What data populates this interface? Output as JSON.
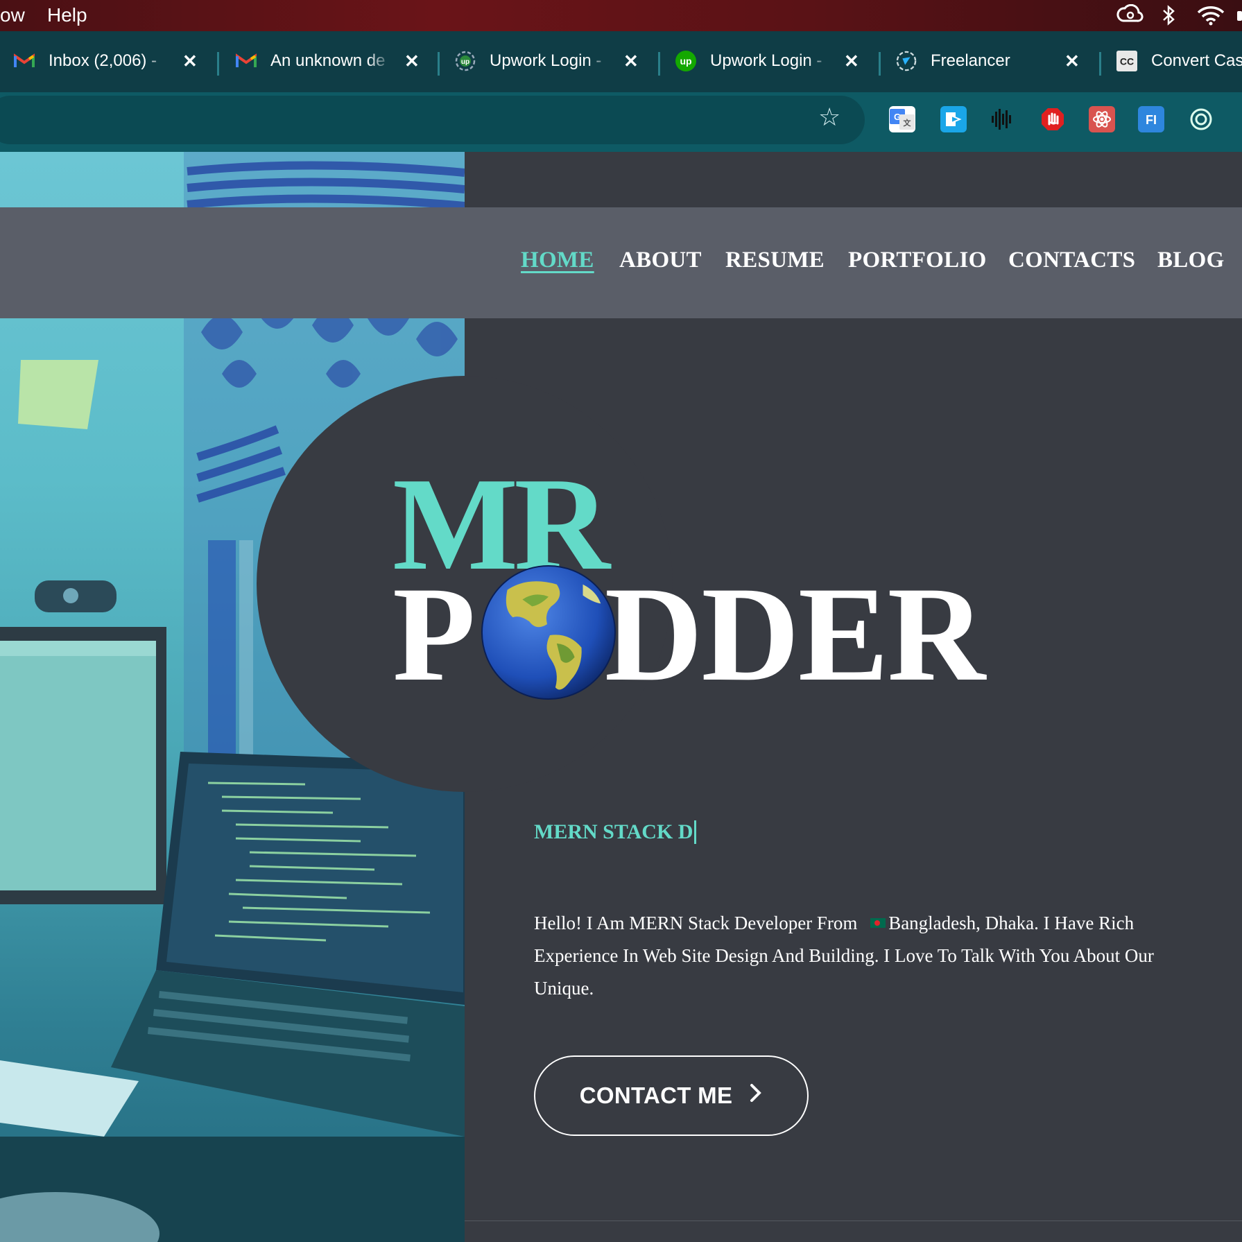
{
  "menubar": {
    "items": [
      "ow",
      "Help"
    ]
  },
  "tabs": [
    {
      "title": "Inbox (2,006) - ",
      "favicon": "gmail-icon",
      "close": "✕"
    },
    {
      "title": "An unknown de",
      "favicon": "gmail-icon",
      "close": "✕"
    },
    {
      "title": "Upwork Login - ",
      "favicon": "upwork-outline-icon",
      "close": "✕"
    },
    {
      "title": "Upwork Login - ",
      "favicon": "upwork-icon",
      "close": "✕"
    },
    {
      "title": "Freelancer",
      "favicon": "freelancer-icon",
      "close": "✕"
    },
    {
      "title": "Convert Cas",
      "favicon": "convert-case-icon",
      "close": ""
    }
  ],
  "toolbar": {
    "bookmark_icon": "star-icon",
    "extensions": [
      "google-translate-icon",
      "send-extension-icon",
      "audio-bars-icon",
      "stop-hand-icon",
      "react-devtools-icon",
      "fi-extension-icon",
      "target-extension-icon"
    ]
  },
  "nav": {
    "items": [
      "HOME",
      "ABOUT",
      "RESUME",
      "PORTFOLIO",
      "CONTACTS",
      "BLOG"
    ],
    "active": "HOME"
  },
  "hero": {
    "logo_line1": "MR",
    "logo_line2_a": "P",
    "logo_line2_b": "DDER",
    "role_typed": "MERN STACK D",
    "bio_part1": "Hello! I Am MERN Stack Developer From ",
    "bio_part2": "Bangladesh, Dhaka. I Have Rich Experience In Web Site Design And Building. I Love To Talk With You About Our Unique.",
    "cta_label": "CONTACT ME",
    "cta_icon": "chevron-right-icon"
  },
  "colors": {
    "accent": "#63dac8",
    "page_bg": "#383b42",
    "navbar_bg": "#5a5e68",
    "tabstrip_bg": "#0f3d46",
    "toolbar_bg": "#0e5a64"
  }
}
